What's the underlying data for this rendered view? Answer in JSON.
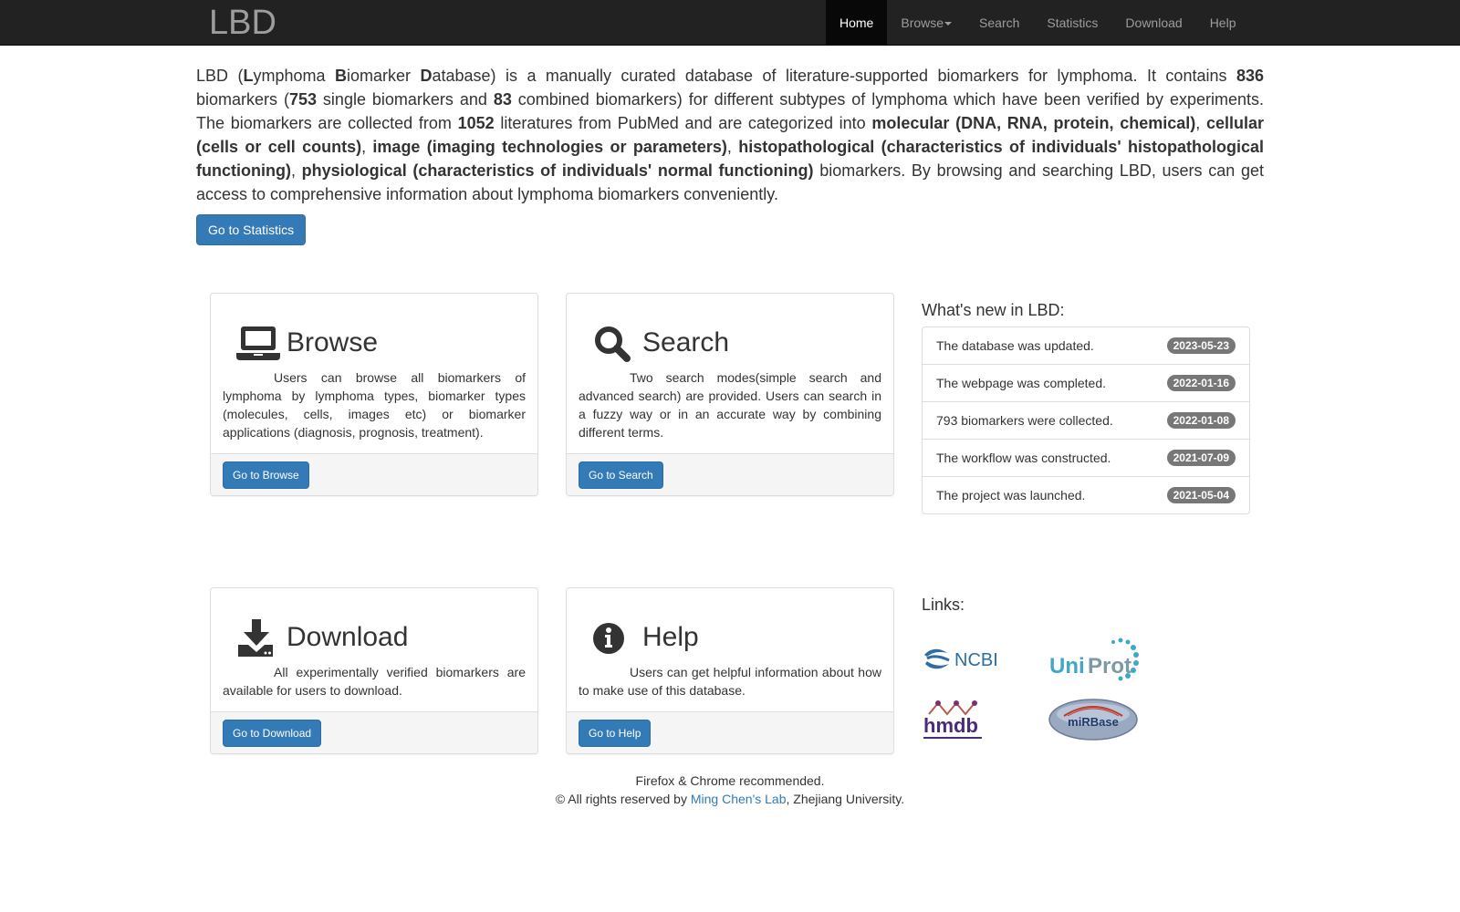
{
  "nav": {
    "brand": "LBD",
    "items": [
      {
        "label": "Home"
      },
      {
        "label": "Browse"
      },
      {
        "label": "Search"
      },
      {
        "label": "Statistics"
      },
      {
        "label": "Download"
      },
      {
        "label": "Help"
      }
    ]
  },
  "intro": {
    "p1": "LBD (",
    "L": "L",
    "ymphoma": "ymphoma ",
    "B": "B",
    "iomarker": "iomarker ",
    "D": "D",
    "atabase": "atabase) is a manually curated database of literature-supported biomarkers for lymphoma. It contains ",
    "total": "836",
    "p2": " biomarkers (",
    "single": "753",
    "p3": " single biomarkers and ",
    "combined": "83",
    "p4": " combined biomarkers) for different subtypes of lymphoma which have been verified by experiments. The biomarkers are collected from ",
    "literatures": "1052",
    "p5": " literatures from PubMed and are categorized into ",
    "cat1": "molecular (DNA, RNA, protein, chemical)",
    "sep1": ", ",
    "cat2": "cellular (cells or cell counts)",
    "sep2": ", ",
    "cat3": "image (imaging technologies or parameters)",
    "sep3": ", ",
    "cat4": "histopathological (characteristics of individuals' histopathological functioning)",
    "sep4": ", ",
    "cat5": "physiological (characteristics of individuals' normal functioning)",
    "p6": " biomarkers. By browsing and searching LBD, users can get access to comprehensive information about lymphoma biomarkers conveniently."
  },
  "stats_button": "Go to Statistics",
  "panels": {
    "browse": {
      "title": "Browse",
      "text": "Users can browse all biomarkers of lymphoma by lymphoma types, biomarker types (molecules, cells, images etc) or biomarker applications (diagnosis, prognosis, treatment).",
      "button": "Go to Browse"
    },
    "search": {
      "title": "Search",
      "text": "Two search modes(simple search and advanced search) are provided. Users can search in a fuzzy way or in an accurate way by combining different terms.",
      "button": "Go to Search"
    },
    "download": {
      "title": "Download",
      "text": "All experimentally verified biomarkers are available for users to download.",
      "button": "Go to Download"
    },
    "help": {
      "title": "Help",
      "text": "Users can get helpful information about how to make use of this database.",
      "button": "Go to Help"
    }
  },
  "news": {
    "title": "What's new in LBD:",
    "items": [
      {
        "text": "The database was updated.",
        "date": "2023-05-23"
      },
      {
        "text": "The webpage was completed.",
        "date": "2022-01-16"
      },
      {
        "text": "793 biomarkers were collected.",
        "date": "2022-01-08"
      },
      {
        "text": "The workflow was constructed.",
        "date": "2021-07-09"
      },
      {
        "text": "The project was launched.",
        "date": "2021-05-04"
      }
    ]
  },
  "links": {
    "title": "Links:",
    "logos": [
      {
        "name": "NCBI",
        "icon": "ncbi-logo"
      },
      {
        "name": "UniProt",
        "icon": "uniprot-logo"
      },
      {
        "name": "hmdb",
        "icon": "hmdb-logo"
      },
      {
        "name": "miRBase",
        "icon": "mirbase-logo"
      }
    ]
  },
  "footer": {
    "line1": "Firefox & Chrome recommended.",
    "line2_pre": "© All rights reserved by ",
    "lab": "Ming Chen's Lab",
    "line2_post": ", Zhejiang University."
  },
  "colors": {
    "navbar": "#222222",
    "primary": "#337ab7",
    "badge": "#777777",
    "link": "#337ab7"
  }
}
